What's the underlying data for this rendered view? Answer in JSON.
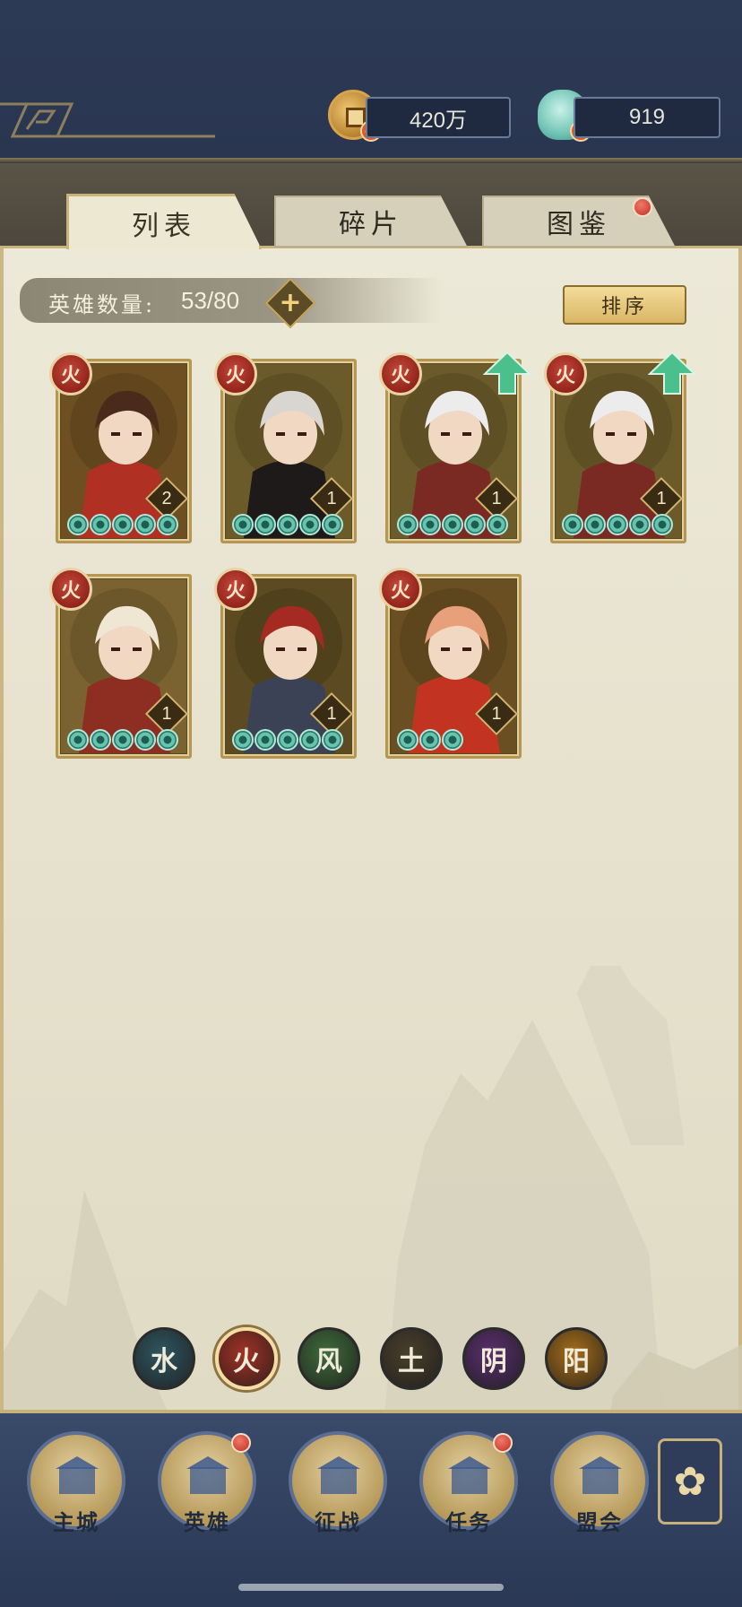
{
  "currencies": {
    "coins": {
      "icon": "copper-coin-icon",
      "value": "420万"
    },
    "jade": {
      "icon": "jade-shell-icon",
      "value": "919"
    }
  },
  "tabs": [
    {
      "label": "列表",
      "active": true
    },
    {
      "label": "碎片",
      "active": false
    },
    {
      "label": "图鉴",
      "active": false,
      "notification": true
    }
  ],
  "hero_count": {
    "label": "英雄数量:",
    "value": "53/80"
  },
  "sort_button": "排序",
  "heroes": [
    {
      "element": "火",
      "level": "2",
      "stars": 5,
      "upgrade": false
    },
    {
      "element": "火",
      "level": "1",
      "stars": 5,
      "upgrade": false
    },
    {
      "element": "火",
      "level": "1",
      "stars": 5,
      "upgrade": true
    },
    {
      "element": "火",
      "level": "1",
      "stars": 5,
      "upgrade": true
    },
    {
      "element": "火",
      "level": "1",
      "stars": 5,
      "upgrade": false
    },
    {
      "element": "火",
      "level": "1",
      "stars": 5,
      "upgrade": false
    },
    {
      "element": "火",
      "level": "1",
      "stars": 3,
      "upgrade": false
    }
  ],
  "element_filters": [
    {
      "glyph": "水",
      "color": "#2f5560",
      "selected": false
    },
    {
      "glyph": "火",
      "color": "#a33225",
      "selected": true
    },
    {
      "glyph": "风",
      "color": "#3f6b3a",
      "selected": false
    },
    {
      "glyph": "土",
      "color": "#4a3f2c",
      "selected": false
    },
    {
      "glyph": "阴",
      "color": "#5a2f6e",
      "selected": false
    },
    {
      "glyph": "阳",
      "color": "#a66d1a",
      "selected": false
    }
  ],
  "nav": [
    {
      "label": "主城",
      "icon": "castle-icon"
    },
    {
      "label": "英雄",
      "icon": "hero-portrait-icon",
      "notification": true
    },
    {
      "label": "征战",
      "icon": "battle-icon"
    },
    {
      "label": "任务",
      "icon": "task-scroll-icon",
      "notification": true
    },
    {
      "label": "盟会",
      "icon": "guild-gate-icon"
    }
  ],
  "nav_more_icon": "flower-menu-icon"
}
